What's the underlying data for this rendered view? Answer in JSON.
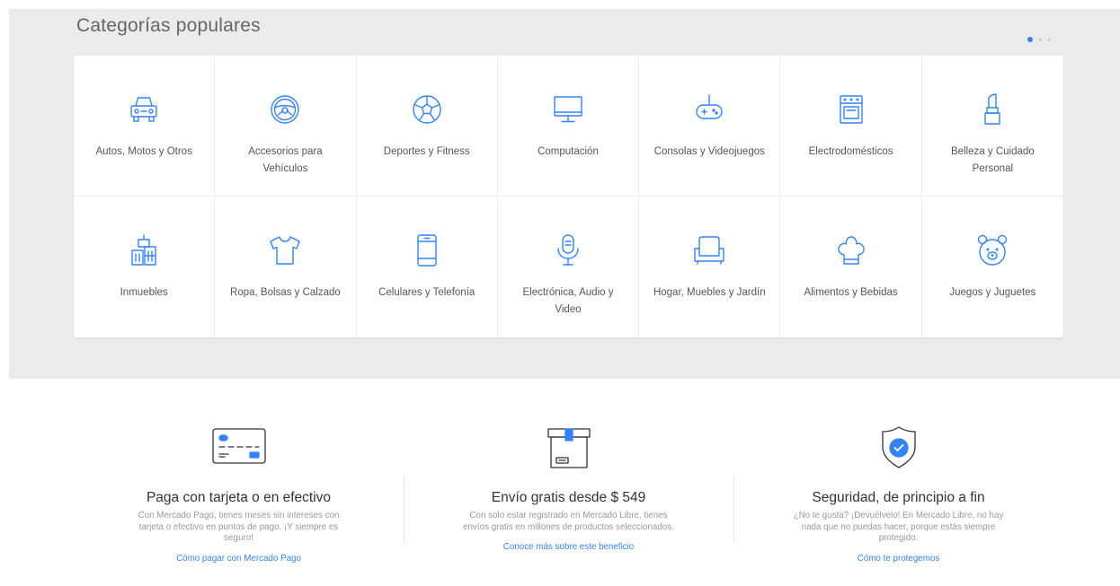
{
  "section": {
    "title": "Categorías populares",
    "pager": {
      "pages": 3,
      "active": 1
    }
  },
  "categories": [
    {
      "label": "Autos, Motos y Otros",
      "icon": "car-icon"
    },
    {
      "label": "Accesorios para Vehículos",
      "icon": "steering-wheel-icon"
    },
    {
      "label": "Deportes y Fitness",
      "icon": "soccer-ball-icon"
    },
    {
      "label": "Computación",
      "icon": "monitor-icon"
    },
    {
      "label": "Consolas y Videojuegos",
      "icon": "gamepad-icon"
    },
    {
      "label": "Electrodomésticos",
      "icon": "oven-icon"
    },
    {
      "label": "Belleza y Cuidado Personal",
      "icon": "lipstick-icon"
    },
    {
      "label": "Inmuebles",
      "icon": "buildings-icon"
    },
    {
      "label": "Ropa, Bolsas y Calzado",
      "icon": "tshirt-icon"
    },
    {
      "label": "Celulares y Telefonía",
      "icon": "cellphone-icon"
    },
    {
      "label": "Electrónica, Audio y Video",
      "icon": "microphone-icon"
    },
    {
      "label": "Hogar, Muebles y Jardín",
      "icon": "armchair-icon"
    },
    {
      "label": "Alimentos y Bebidas",
      "icon": "chef-hat-icon"
    },
    {
      "label": "Juegos y Juguetes",
      "icon": "teddy-bear-icon"
    }
  ],
  "benefits": [
    {
      "title": "Paga con tarjeta o en efectivo",
      "description": "Con Mercado Pago, tienes meses sin intereses con tarjeta o efectivo en puntos de pago. ¡Y siempre es seguro!",
      "link": "Cómo pagar con Mercado Pago",
      "icon": "credit-card-icon"
    },
    {
      "title": "Envío gratis desde $ 549",
      "description": "Con solo estar registrado en Mercado Libre, tienes envíos gratis en millones de productos seleccionados.",
      "link": "Conoce más sobre este beneficio",
      "icon": "shipping-box-icon"
    },
    {
      "title": "Seguridad, de principio a fin",
      "description": "¿No te gusta? ¡Devuélvelo! En Mercado Libre, no hay nada que no puedas hacer, porque estás siempre protegido.",
      "link": "Cómo te protegemos",
      "icon": "shield-check-icon"
    }
  ],
  "colors": {
    "accent": "#3483fa",
    "background": "#ebebeb",
    "text": "#555555"
  }
}
